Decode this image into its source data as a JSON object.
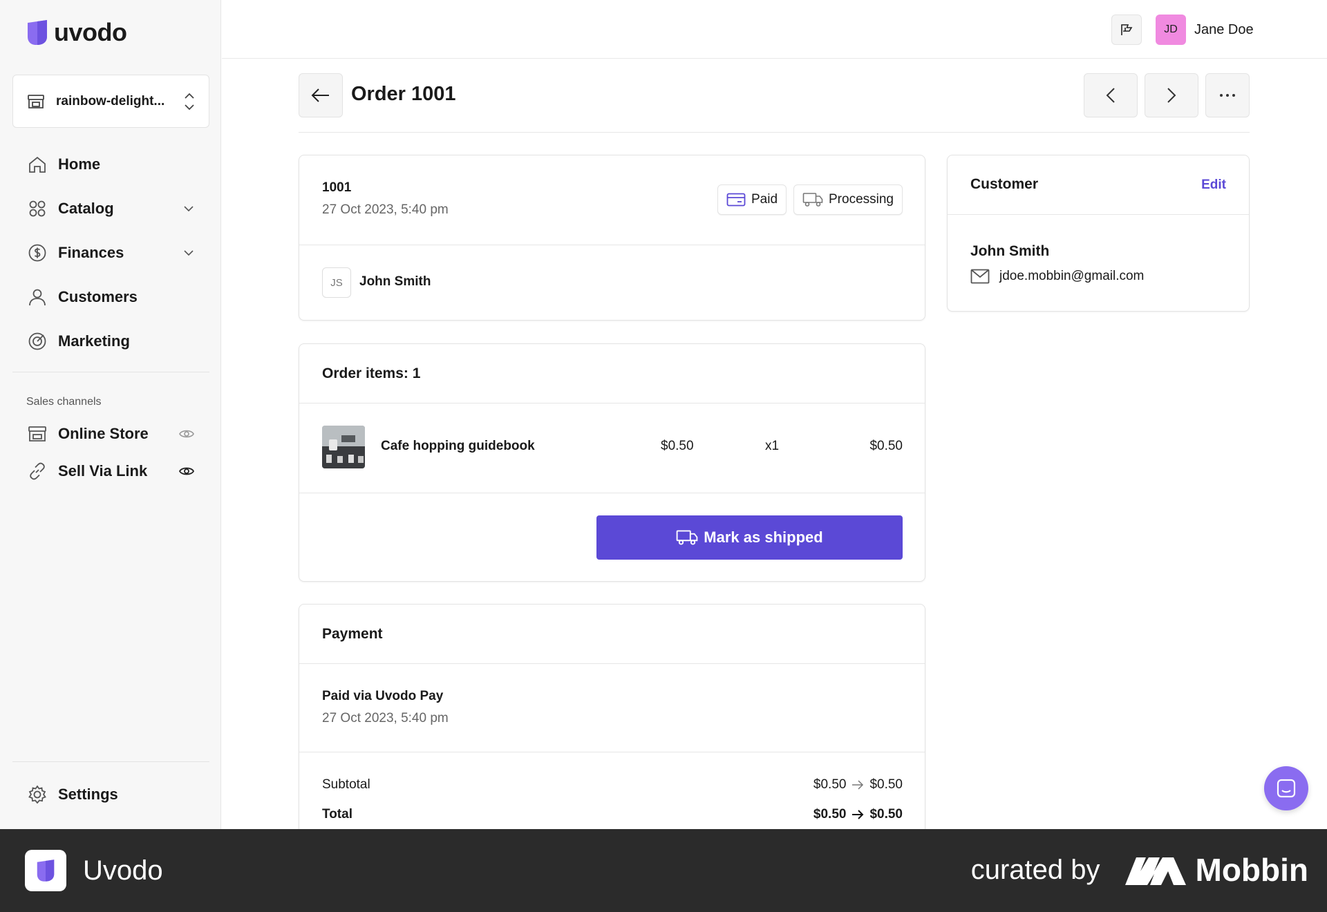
{
  "app": {
    "name": "uvodo"
  },
  "store_select": {
    "name": "rainbow-delight..."
  },
  "nav": {
    "home": "Home",
    "catalog": "Catalog",
    "finances": "Finances",
    "customers": "Customers",
    "marketing": "Marketing"
  },
  "sales_channels": {
    "label": "Sales channels",
    "online_store": "Online Store",
    "sell_via_link": "Sell Via Link"
  },
  "settings": "Settings",
  "topbar": {
    "user_initials": "JD",
    "user_name": "Jane Doe"
  },
  "page": {
    "title": "Order 1001"
  },
  "order": {
    "number": "1001",
    "date": "27 Oct 2023, 5:40 pm",
    "payment_status": "Paid",
    "fulfillment_status": "Processing",
    "customer_initials": "JS",
    "customer_name": "John Smith"
  },
  "order_items": {
    "title": "Order items: 1",
    "items": [
      {
        "name": "Cafe hopping guidebook",
        "price": "$0.50",
        "qty": "x1",
        "total": "$0.50"
      }
    ],
    "ship_button": "Mark as shipped"
  },
  "payment": {
    "title": "Payment",
    "method": "Paid via Uvodo Pay",
    "date": "27 Oct 2023, 5:40 pm",
    "subtotal_label": "Subtotal",
    "subtotal_from": "$0.50",
    "subtotal_to": "$0.50",
    "total_label": "Total",
    "total_from": "$0.50",
    "total_to": "$0.50"
  },
  "customer_card": {
    "title": "Customer",
    "edit": "Edit",
    "name": "John Smith",
    "email": "jdoe.mobbin@gmail.com"
  },
  "footer": {
    "app_name": "Uvodo",
    "curated_by": "curated by",
    "brand": "Mobbin"
  },
  "colors": {
    "accent": "#5b49d6",
    "logo": "#8a6cf0",
    "avatar": "#f08ae0",
    "footer_bg": "#2b2b2b"
  }
}
